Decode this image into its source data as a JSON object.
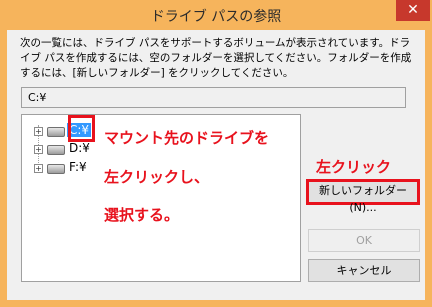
{
  "window": {
    "title": "ドライブ パスの参照",
    "close_glyph": "✕"
  },
  "description": "次の一覧には、ドライブ パスをサポートするボリュームが表示されています。ドライブ パスを作成するには、空のフォルダーを選択してください。フォルダーを作成するには、[新しいフォルダー] をクリックしてください。",
  "path_value": "C:¥",
  "tree": {
    "items": [
      {
        "label": "C:¥",
        "selected": true
      },
      {
        "label": "D:¥",
        "selected": false
      },
      {
        "label": "F:¥",
        "selected": false
      }
    ]
  },
  "annotations": {
    "left_click_line1": "マウント先のドライブを",
    "left_click_line2": "左クリックし、",
    "left_click_line3": "選択する。",
    "right_click": "左クリック"
  },
  "buttons": {
    "new_folder": "新しいフォルダー(N)...",
    "ok": "OK",
    "cancel": "キャンセル"
  },
  "colors": {
    "accent_red": "#e8121d",
    "frame": "#f6b45c",
    "selection": "#3399ff"
  }
}
